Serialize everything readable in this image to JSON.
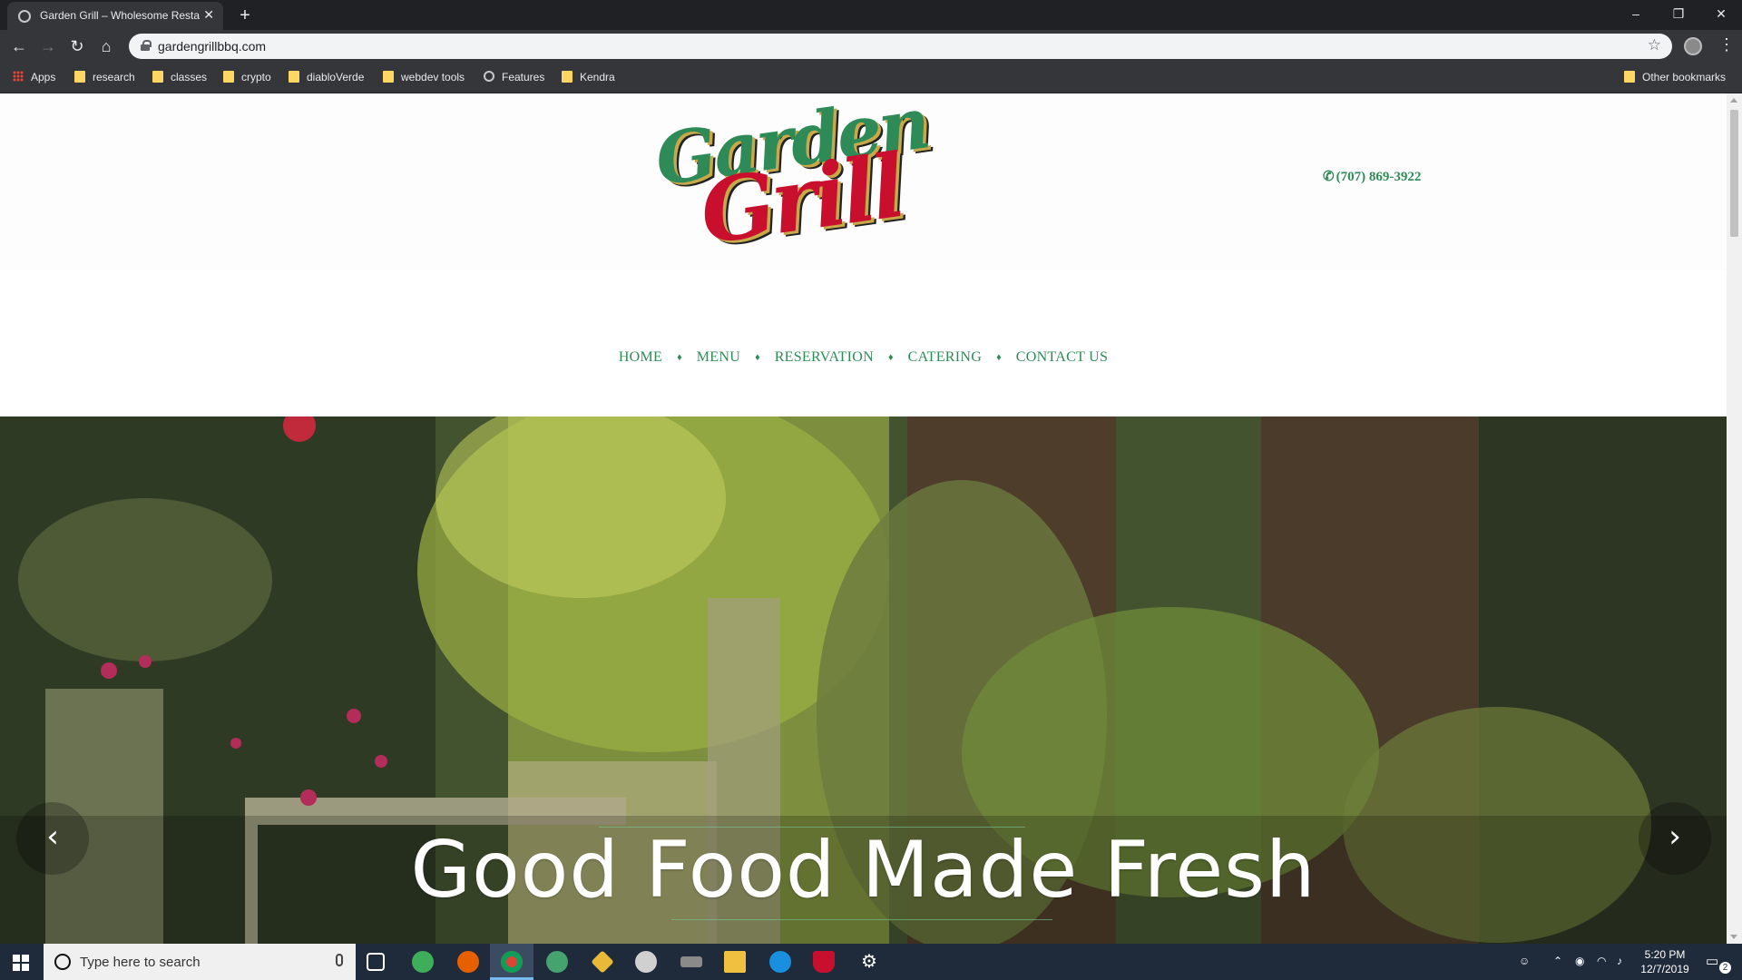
{
  "browser": {
    "tab_title": "Garden Grill – Wholesome Resta",
    "new_tab": "+",
    "close_tab": "✕",
    "url": "gardengrillbbq.com",
    "window_controls": {
      "minimize": "–",
      "restore": "❐",
      "close": "✕"
    },
    "nav": {
      "back": "←",
      "forward": "→",
      "reload": "↻",
      "home": "⌂"
    },
    "star": "☆",
    "menu": "⋮"
  },
  "bookmarks": [
    {
      "label": "Apps",
      "icon": "apps-grid-icon"
    },
    {
      "label": "research",
      "icon": "folder-icon"
    },
    {
      "label": "classes",
      "icon": "folder-icon"
    },
    {
      "label": "crypto",
      "icon": "folder-icon"
    },
    {
      "label": "diabloVerde",
      "icon": "folder-icon"
    },
    {
      "label": "webdev tools",
      "icon": "folder-icon"
    },
    {
      "label": "Features",
      "icon": "globe-icon"
    },
    {
      "label": "Kendra",
      "icon": "folder-icon"
    }
  ],
  "other_bookmarks": "Other bookmarks",
  "site": {
    "logo_line1": "Garden",
    "logo_line2": "Grill",
    "phone": "(707) 869-3922",
    "phone_icon": "✆",
    "nav": [
      "HOME",
      "MENU",
      "RESERVATION",
      "CATERING",
      "CONTACT US"
    ],
    "nav_separator": "♦",
    "hero_title": "Good Food Made Fresh",
    "prev": "‹",
    "next": "›"
  },
  "taskbar": {
    "search_placeholder": "Type here to search",
    "time": "5:20 PM",
    "date": "12/7/2019",
    "notification_count": "2"
  },
  "colors": {
    "brand_green": "#2e8b57",
    "brand_red": "#c8102e",
    "chrome_dark": "#202124",
    "taskbar": "#1f2a3a"
  }
}
